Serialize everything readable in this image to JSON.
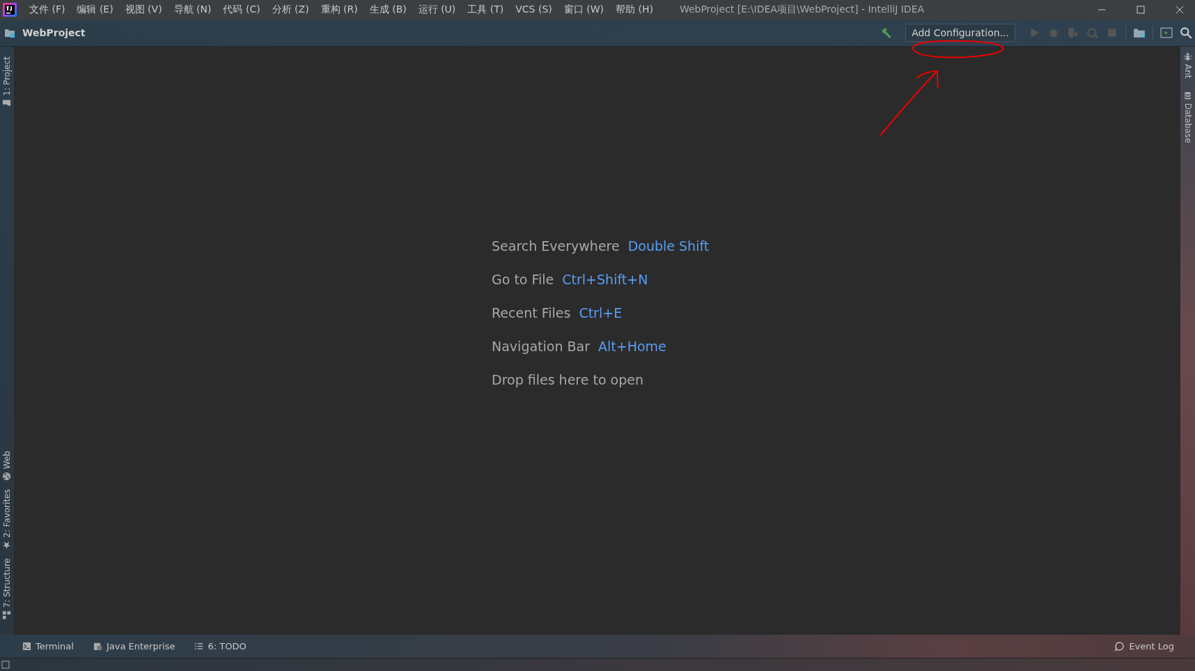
{
  "window": {
    "title": "WebProject [E:\\IDEA项目\\WebProject] - IntelliJ IDEA"
  },
  "menu": [
    "文件 (F)",
    "编辑 (E)",
    "视图 (V)",
    "导航 (N)",
    "代码 (C)",
    "分析 (Z)",
    "重构 (R)",
    "生成 (B)",
    "运行 (U)",
    "工具 (T)",
    "VCS (S)",
    "窗口 (W)",
    "帮助 (H)"
  ],
  "navbar": {
    "project": "WebProject",
    "run_configuration": "Add Configuration..."
  },
  "tips": [
    {
      "action": "Search Everywhere",
      "shortcut": "Double Shift"
    },
    {
      "action": "Go to File",
      "shortcut": "Ctrl+Shift+N"
    },
    {
      "action": "Recent Files",
      "shortcut": "Ctrl+E"
    },
    {
      "action": "Navigation Bar",
      "shortcut": "Alt+Home"
    }
  ],
  "drop_hint": "Drop files here to open",
  "left_tools": [
    {
      "label": "1: Project",
      "kind": "folder"
    },
    {
      "label": "Web",
      "kind": "globe"
    },
    {
      "label": "2: Favorites",
      "kind": "star"
    },
    {
      "label": "7: Structure",
      "kind": "structure"
    }
  ],
  "right_tools": [
    {
      "label": "Ant",
      "kind": "ant"
    },
    {
      "label": "Database",
      "kind": "database"
    }
  ],
  "bottom_tools": [
    {
      "label": "Terminal",
      "kind": "terminal"
    },
    {
      "label": "Java Enterprise",
      "kind": "enterprise"
    },
    {
      "label": "6: TODO",
      "kind": "list"
    }
  ],
  "event_log": "Event Log"
}
